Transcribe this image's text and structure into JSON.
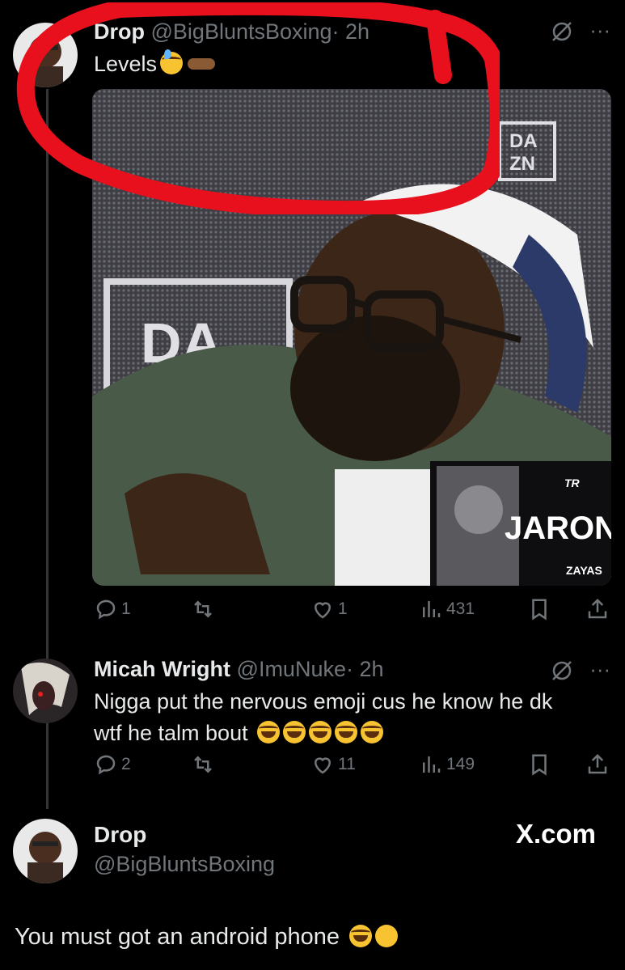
{
  "tweet1": {
    "name": "Drop",
    "handle": "@BigBluntsBoxing",
    "time": "· 2h",
    "text": "Levels",
    "emoji": [
      "sweat-smile-emoji",
      "pointing-left-emoji"
    ],
    "media": {
      "logo_small": "DA\nZN",
      "logo_back": "DA",
      "card_name": "JARON",
      "card_surname": "ZAYAS",
      "card_tr": "TR"
    },
    "stats": {
      "replies": "1",
      "reposts": "",
      "likes": "1",
      "views": "431"
    }
  },
  "tweet2": {
    "name": "Micah Wright",
    "handle": "@ImuNuke",
    "time": "· 2h",
    "text_line1": "Nigga put the nervous emoji cus he know he dk",
    "text_line2": "wtf he talm bout",
    "emoji_count": 5,
    "stats": {
      "replies": "2",
      "reposts": "",
      "likes": "11",
      "views": "149"
    }
  },
  "reply": {
    "name": "Drop",
    "handle": "@BigBluntsBoxing",
    "brand": "X.com",
    "text": "You must got an android phone",
    "emoji": [
      "rolling-laughing-emoji",
      "crying-emoji"
    ]
  },
  "icons": {
    "grok": "grok-icon",
    "more": "···"
  },
  "colors": {
    "background": "#000000",
    "text": "#e7e9ea",
    "muted": "#71767b",
    "annotation": "#e8101c"
  }
}
